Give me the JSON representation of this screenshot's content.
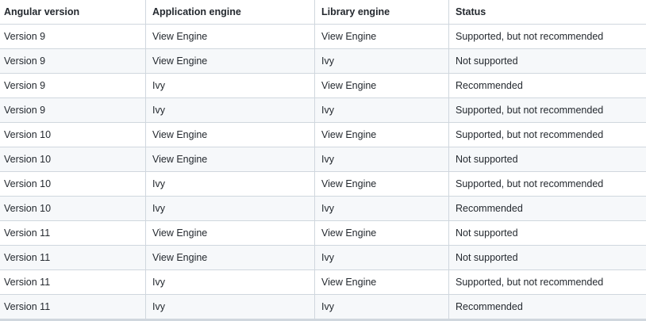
{
  "table": {
    "headers": [
      "Angular version",
      "Application engine",
      "Library engine",
      "Status"
    ],
    "rows": [
      [
        "Version 9",
        "View Engine",
        "View Engine",
        "Supported, but not recommended"
      ],
      [
        "Version 9",
        "View Engine",
        "Ivy",
        "Not supported"
      ],
      [
        "Version 9",
        "Ivy",
        "View Engine",
        "Recommended"
      ],
      [
        "Version 9",
        "Ivy",
        "Ivy",
        "Supported, but not recommended"
      ],
      [
        "Version 10",
        "View Engine",
        "View Engine",
        "Supported, but not recommended"
      ],
      [
        "Version 10",
        "View Engine",
        "Ivy",
        "Not supported"
      ],
      [
        "Version 10",
        "Ivy",
        "View Engine",
        "Supported, but not recommended"
      ],
      [
        "Version 10",
        "Ivy",
        "Ivy",
        "Recommended"
      ],
      [
        "Version 11",
        "View Engine",
        "View Engine",
        "Not supported"
      ],
      [
        "Version 11",
        "View Engine",
        "Ivy",
        "Not supported"
      ],
      [
        "Version 11",
        "Ivy",
        "View Engine",
        "Supported, but not recommended"
      ],
      [
        "Version 11",
        "Ivy",
        "Ivy",
        "Recommended"
      ]
    ]
  }
}
